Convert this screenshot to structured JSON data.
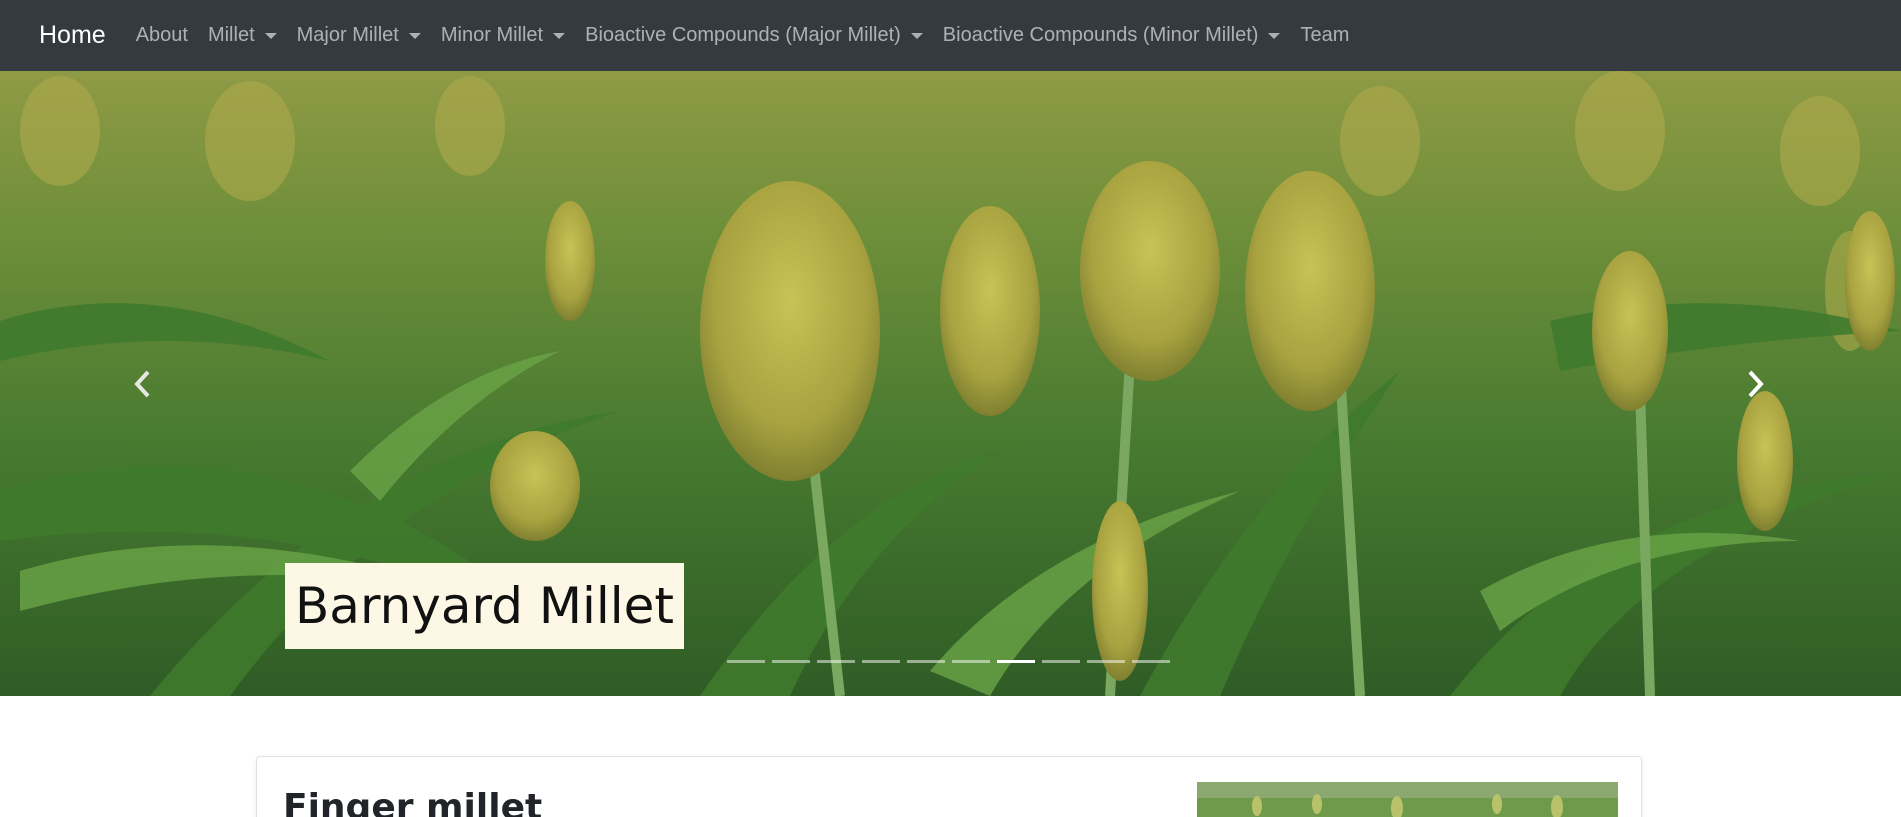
{
  "navbar": {
    "brand": "Home",
    "items": [
      {
        "label": "About",
        "dropdown": false
      },
      {
        "label": "Millet",
        "dropdown": true
      },
      {
        "label": "Major Millet",
        "dropdown": true
      },
      {
        "label": "Minor Millet",
        "dropdown": true
      },
      {
        "label": "Bioactive Compounds (Major Millet)",
        "dropdown": true
      },
      {
        "label": "Bioactive Compounds (Minor Millet)",
        "dropdown": true
      },
      {
        "label": "Team",
        "dropdown": false
      }
    ]
  },
  "carousel": {
    "caption": "Barnyard Millet",
    "slide_count": 10,
    "active_index": 6,
    "prev_icon": "chevron-left-icon",
    "next_icon": "chevron-right-icon"
  },
  "card": {
    "title": "Finger millet"
  },
  "colors": {
    "navbar_bg": "#343a40",
    "caption_bg": "#fdf8e6",
    "field_green": "#4f7d35"
  }
}
